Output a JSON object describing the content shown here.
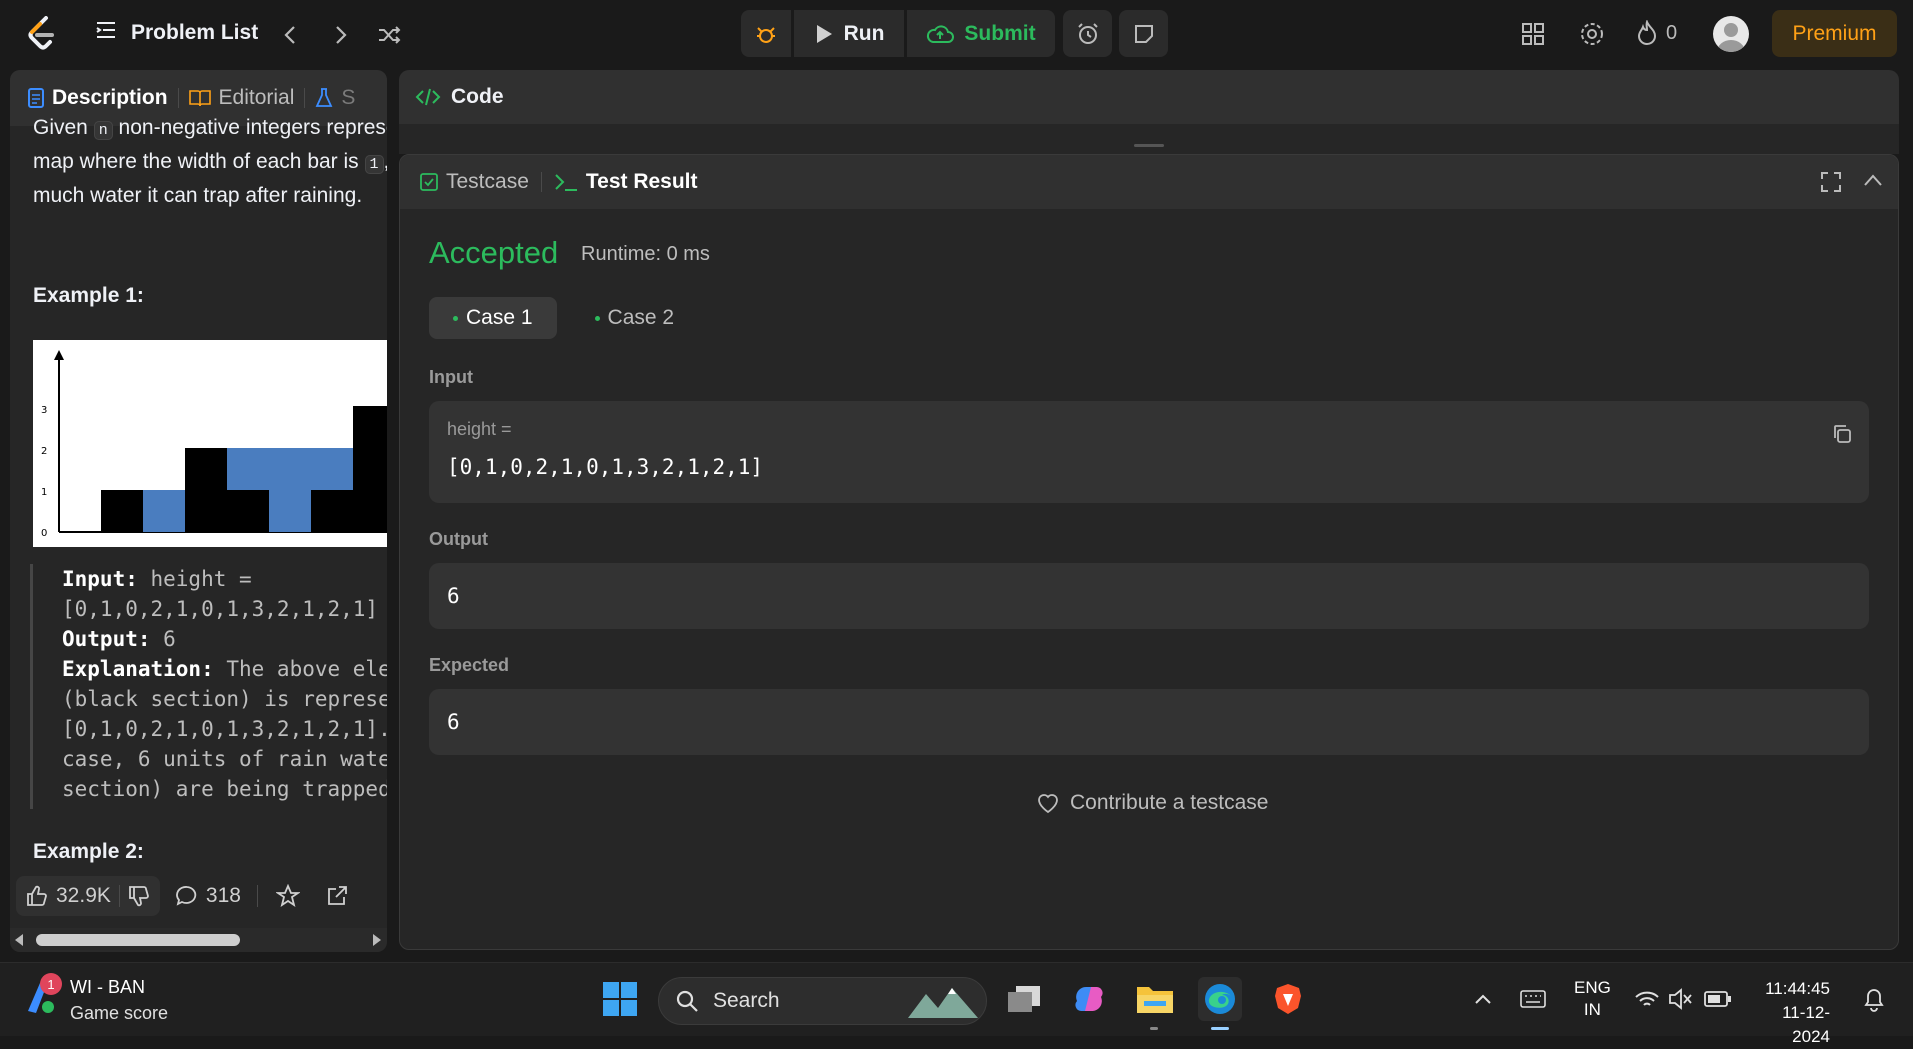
{
  "header": {
    "problem_list": "Problem List",
    "run": "Run",
    "submit": "Submit",
    "streak_count": "0",
    "premium": "Premium"
  },
  "left": {
    "tabs": [
      "Description",
      "Editorial",
      "S"
    ],
    "desc_a": "Given",
    "desc_n": "n",
    "desc_b": " non-negative integers represe",
    "desc_c": "map where the width of each bar is ",
    "desc_one": "1",
    "desc_d": ",",
    "desc_e": "much water it can trap after raining.",
    "example1": "Example 1:",
    "example2": "Example 2:",
    "chart_axis": [
      "0",
      "1",
      "2",
      "3"
    ],
    "ex_input_label": "Input:",
    "ex_input": " height =",
    "ex_input2": "[0,1,0,2,1,0,1,3,2,1,2,1]",
    "ex_output_label": "Output:",
    "ex_output": " 6",
    "ex_expl_label": "Explanation:",
    "ex_expl1": " The above ele",
    "ex_expl2": "(black section) is represe",
    "ex_expl3": "[0,1,0,2,1,0,1,3,2,1,2,1].",
    "ex_expl4": "case, 6 units of rain wate",
    "ex_expl5": "section) are being trapped",
    "likes": "32.9K",
    "comments": "318"
  },
  "code": {
    "title": "Code"
  },
  "result": {
    "tab_testcase": "Testcase",
    "tab_result": "Test Result",
    "status": "Accepted",
    "runtime": "Runtime: 0 ms",
    "case1": "Case 1",
    "case2": "Case 2",
    "input_label": "Input",
    "input_var": "height =",
    "input_value": "[0,1,0,2,1,0,1,3,2,1,2,1]",
    "output_label": "Output",
    "output_value": "6",
    "expected_label": "Expected",
    "expected_value": "6",
    "contribute": "Contribute a testcase"
  },
  "taskbar": {
    "notify_count": "1",
    "widget_title": "WI - BAN",
    "widget_sub": "Game score",
    "search": "Search",
    "lang1": "ENG",
    "lang2": "IN",
    "time": "11:44:45",
    "date": "11-12-2024"
  },
  "colors": {
    "accent": "#ffa116",
    "success": "#2cbb5d",
    "water": "#4a7dbf"
  }
}
